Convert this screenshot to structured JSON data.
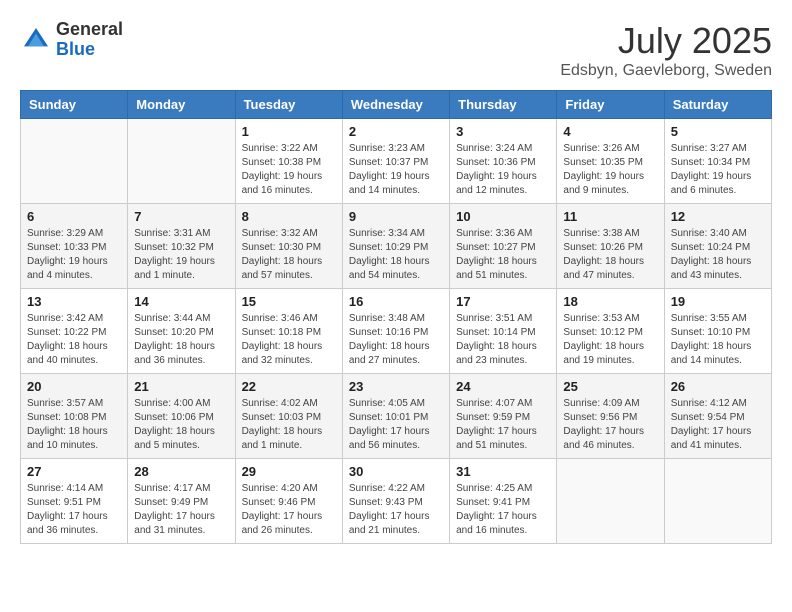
{
  "header": {
    "logo_line1": "General",
    "logo_line2": "Blue",
    "month": "July 2025",
    "location": "Edsbyn, Gaevleborg, Sweden"
  },
  "days_of_week": [
    "Sunday",
    "Monday",
    "Tuesday",
    "Wednesday",
    "Thursday",
    "Friday",
    "Saturday"
  ],
  "weeks": [
    [
      {
        "day": "",
        "sunrise": "",
        "sunset": "",
        "daylight": ""
      },
      {
        "day": "",
        "sunrise": "",
        "sunset": "",
        "daylight": ""
      },
      {
        "day": "1",
        "sunrise": "Sunrise: 3:22 AM",
        "sunset": "Sunset: 10:38 PM",
        "daylight": "Daylight: 19 hours and 16 minutes."
      },
      {
        "day": "2",
        "sunrise": "Sunrise: 3:23 AM",
        "sunset": "Sunset: 10:37 PM",
        "daylight": "Daylight: 19 hours and 14 minutes."
      },
      {
        "day": "3",
        "sunrise": "Sunrise: 3:24 AM",
        "sunset": "Sunset: 10:36 PM",
        "daylight": "Daylight: 19 hours and 12 minutes."
      },
      {
        "day": "4",
        "sunrise": "Sunrise: 3:26 AM",
        "sunset": "Sunset: 10:35 PM",
        "daylight": "Daylight: 19 hours and 9 minutes."
      },
      {
        "day": "5",
        "sunrise": "Sunrise: 3:27 AM",
        "sunset": "Sunset: 10:34 PM",
        "daylight": "Daylight: 19 hours and 6 minutes."
      }
    ],
    [
      {
        "day": "6",
        "sunrise": "Sunrise: 3:29 AM",
        "sunset": "Sunset: 10:33 PM",
        "daylight": "Daylight: 19 hours and 4 minutes."
      },
      {
        "day": "7",
        "sunrise": "Sunrise: 3:31 AM",
        "sunset": "Sunset: 10:32 PM",
        "daylight": "Daylight: 19 hours and 1 minute."
      },
      {
        "day": "8",
        "sunrise": "Sunrise: 3:32 AM",
        "sunset": "Sunset: 10:30 PM",
        "daylight": "Daylight: 18 hours and 57 minutes."
      },
      {
        "day": "9",
        "sunrise": "Sunrise: 3:34 AM",
        "sunset": "Sunset: 10:29 PM",
        "daylight": "Daylight: 18 hours and 54 minutes."
      },
      {
        "day": "10",
        "sunrise": "Sunrise: 3:36 AM",
        "sunset": "Sunset: 10:27 PM",
        "daylight": "Daylight: 18 hours and 51 minutes."
      },
      {
        "day": "11",
        "sunrise": "Sunrise: 3:38 AM",
        "sunset": "Sunset: 10:26 PM",
        "daylight": "Daylight: 18 hours and 47 minutes."
      },
      {
        "day": "12",
        "sunrise": "Sunrise: 3:40 AM",
        "sunset": "Sunset: 10:24 PM",
        "daylight": "Daylight: 18 hours and 43 minutes."
      }
    ],
    [
      {
        "day": "13",
        "sunrise": "Sunrise: 3:42 AM",
        "sunset": "Sunset: 10:22 PM",
        "daylight": "Daylight: 18 hours and 40 minutes."
      },
      {
        "day": "14",
        "sunrise": "Sunrise: 3:44 AM",
        "sunset": "Sunset: 10:20 PM",
        "daylight": "Daylight: 18 hours and 36 minutes."
      },
      {
        "day": "15",
        "sunrise": "Sunrise: 3:46 AM",
        "sunset": "Sunset: 10:18 PM",
        "daylight": "Daylight: 18 hours and 32 minutes."
      },
      {
        "day": "16",
        "sunrise": "Sunrise: 3:48 AM",
        "sunset": "Sunset: 10:16 PM",
        "daylight": "Daylight: 18 hours and 27 minutes."
      },
      {
        "day": "17",
        "sunrise": "Sunrise: 3:51 AM",
        "sunset": "Sunset: 10:14 PM",
        "daylight": "Daylight: 18 hours and 23 minutes."
      },
      {
        "day": "18",
        "sunrise": "Sunrise: 3:53 AM",
        "sunset": "Sunset: 10:12 PM",
        "daylight": "Daylight: 18 hours and 19 minutes."
      },
      {
        "day": "19",
        "sunrise": "Sunrise: 3:55 AM",
        "sunset": "Sunset: 10:10 PM",
        "daylight": "Daylight: 18 hours and 14 minutes."
      }
    ],
    [
      {
        "day": "20",
        "sunrise": "Sunrise: 3:57 AM",
        "sunset": "Sunset: 10:08 PM",
        "daylight": "Daylight: 18 hours and 10 minutes."
      },
      {
        "day": "21",
        "sunrise": "Sunrise: 4:00 AM",
        "sunset": "Sunset: 10:06 PM",
        "daylight": "Daylight: 18 hours and 5 minutes."
      },
      {
        "day": "22",
        "sunrise": "Sunrise: 4:02 AM",
        "sunset": "Sunset: 10:03 PM",
        "daylight": "Daylight: 18 hours and 1 minute."
      },
      {
        "day": "23",
        "sunrise": "Sunrise: 4:05 AM",
        "sunset": "Sunset: 10:01 PM",
        "daylight": "Daylight: 17 hours and 56 minutes."
      },
      {
        "day": "24",
        "sunrise": "Sunrise: 4:07 AM",
        "sunset": "Sunset: 9:59 PM",
        "daylight": "Daylight: 17 hours and 51 minutes."
      },
      {
        "day": "25",
        "sunrise": "Sunrise: 4:09 AM",
        "sunset": "Sunset: 9:56 PM",
        "daylight": "Daylight: 17 hours and 46 minutes."
      },
      {
        "day": "26",
        "sunrise": "Sunrise: 4:12 AM",
        "sunset": "Sunset: 9:54 PM",
        "daylight": "Daylight: 17 hours and 41 minutes."
      }
    ],
    [
      {
        "day": "27",
        "sunrise": "Sunrise: 4:14 AM",
        "sunset": "Sunset: 9:51 PM",
        "daylight": "Daylight: 17 hours and 36 minutes."
      },
      {
        "day": "28",
        "sunrise": "Sunrise: 4:17 AM",
        "sunset": "Sunset: 9:49 PM",
        "daylight": "Daylight: 17 hours and 31 minutes."
      },
      {
        "day": "29",
        "sunrise": "Sunrise: 4:20 AM",
        "sunset": "Sunset: 9:46 PM",
        "daylight": "Daylight: 17 hours and 26 minutes."
      },
      {
        "day": "30",
        "sunrise": "Sunrise: 4:22 AM",
        "sunset": "Sunset: 9:43 PM",
        "daylight": "Daylight: 17 hours and 21 minutes."
      },
      {
        "day": "31",
        "sunrise": "Sunrise: 4:25 AM",
        "sunset": "Sunset: 9:41 PM",
        "daylight": "Daylight: 17 hours and 16 minutes."
      },
      {
        "day": "",
        "sunrise": "",
        "sunset": "",
        "daylight": ""
      },
      {
        "day": "",
        "sunrise": "",
        "sunset": "",
        "daylight": ""
      }
    ]
  ]
}
